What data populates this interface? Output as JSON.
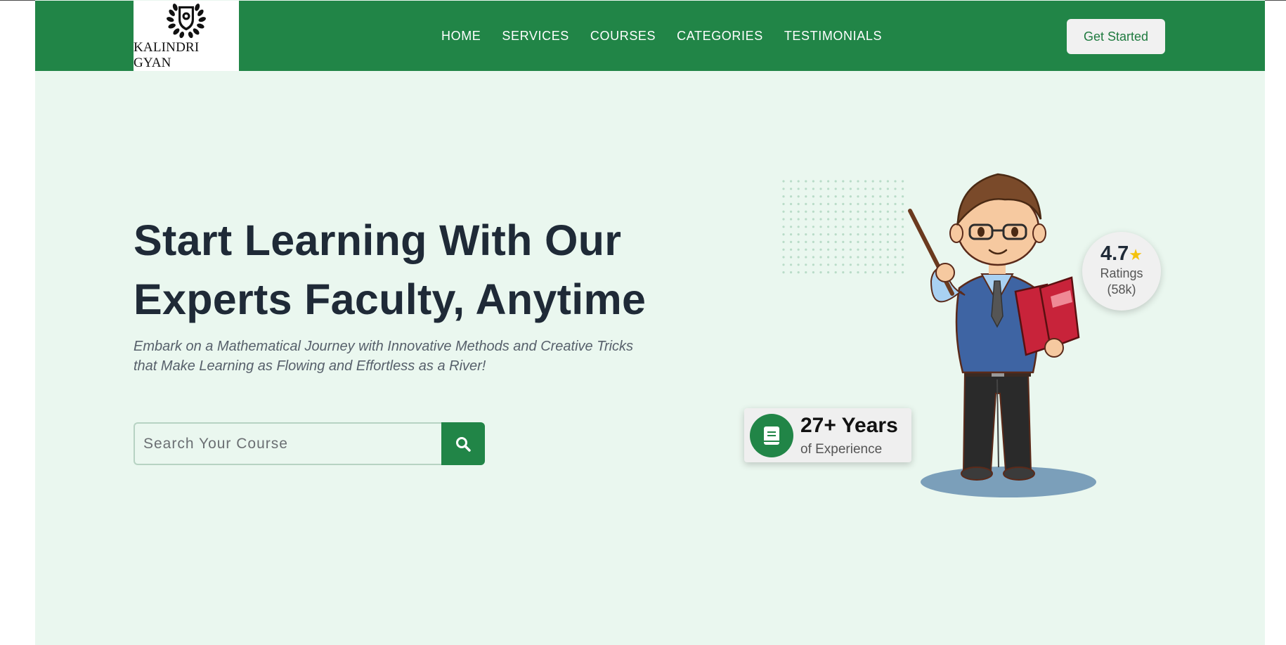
{
  "brand": {
    "name": "KALINDRI GYAN",
    "colors": {
      "primary": "#218547",
      "hero_bg": "#eaf7ef",
      "heading": "#1f2a37",
      "star": "#f4c20d"
    }
  },
  "nav": {
    "items": [
      {
        "label": "HOME"
      },
      {
        "label": "SERVICES"
      },
      {
        "label": "COURSES"
      },
      {
        "label": "CATEGORIES"
      },
      {
        "label": "TESTIMONIALS"
      }
    ],
    "cta_label": "Get Started"
  },
  "hero": {
    "title_line1": "Start Learning With Our",
    "title_line2": "Experts Faculty, Anytime",
    "subtitle_line1": "Embark on a Mathematical Journey with Innovative Methods and Creative Tricks",
    "subtitle_line2": "that Make Learning as Flowing and Effortless as a River!"
  },
  "search": {
    "placeholder": "Search Your Course",
    "value": "",
    "button_icon": "search-icon"
  },
  "rating": {
    "value": "4.7",
    "star_icon": "star-icon",
    "label": "Ratings",
    "count": "(58k)"
  },
  "experience": {
    "icon": "book-icon",
    "title": "27+ Years",
    "subtitle": "of Experience"
  },
  "illustration": {
    "subject": "teacher-illustration"
  }
}
